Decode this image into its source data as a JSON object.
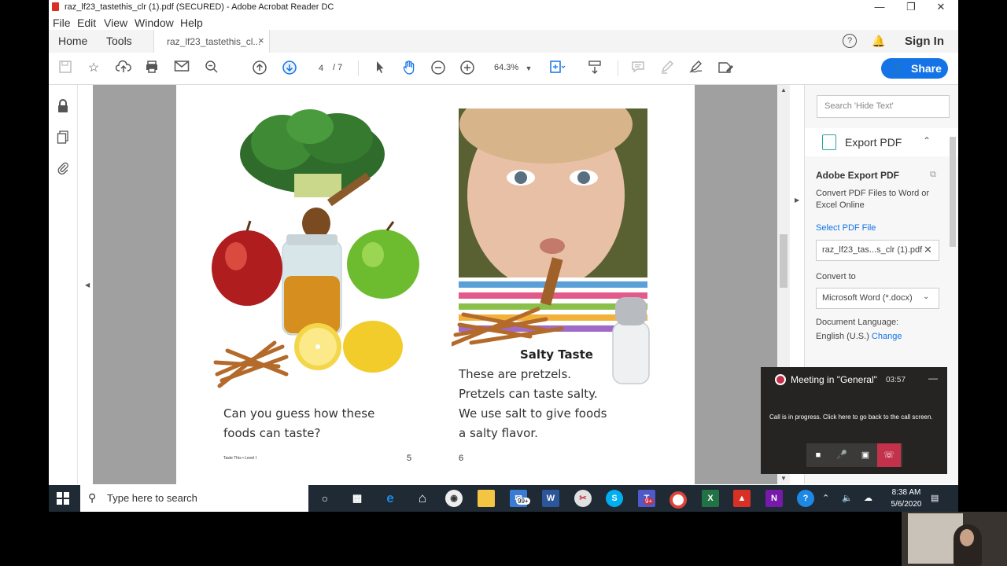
{
  "window": {
    "title": "raz_lf23_tastethis_clr (1).pdf (SECURED) - Adobe Acrobat Reader DC",
    "minimize": "—",
    "restore": "❐",
    "close": "✕"
  },
  "menu": [
    "File",
    "Edit",
    "View",
    "Window",
    "Help"
  ],
  "tabs": {
    "home": "Home",
    "tools": "Tools",
    "document": "raz_lf23_tastethis_cl...",
    "close": "×"
  },
  "header": {
    "help": "?",
    "sign_in": "Sign In"
  },
  "toolbar": {
    "page_current": "4",
    "page_total": "/ 7",
    "zoom": "64.3%",
    "share": "Share"
  },
  "page": {
    "left_caption_line1": "Can you guess how these",
    "left_caption_line2": "foods can taste?",
    "left_footer": "Taste This • Level I",
    "left_page_number": "5",
    "right_heading": "Salty Taste",
    "right_caption_line1": "These are pretzels.",
    "right_caption_line2": "Pretzels can taste salty.",
    "right_caption_line3": "We use salt to give foods",
    "right_caption_line4": "a salty flavor.",
    "right_page_number": "6"
  },
  "right_panel": {
    "search_placeholder": "Search 'Hide Text'",
    "export_header": "Export PDF",
    "export_title": "Adobe Export PDF",
    "export_desc": "Convert PDF Files to Word or Excel Online",
    "select_file": "Select PDF File",
    "file_name": "raz_lf23_tas...s_clr (1).pdf",
    "convert_to_label": "Convert to",
    "convert_to_value": "Microsoft Word (*.docx)",
    "doc_language_label": "Document Language:",
    "doc_language_value": "English (U.S.)",
    "change": "Change"
  },
  "teams_popup": {
    "meeting": "Meeting in \"General\"",
    "time": "03:57",
    "message": "Call is in progress. Click here to go back to the call screen."
  },
  "taskbar": {
    "search_placeholder": "Type here to search",
    "mail_badge": "99+",
    "teams_badge": "9+",
    "time": "8:38 AM",
    "date": "5/6/2020"
  }
}
